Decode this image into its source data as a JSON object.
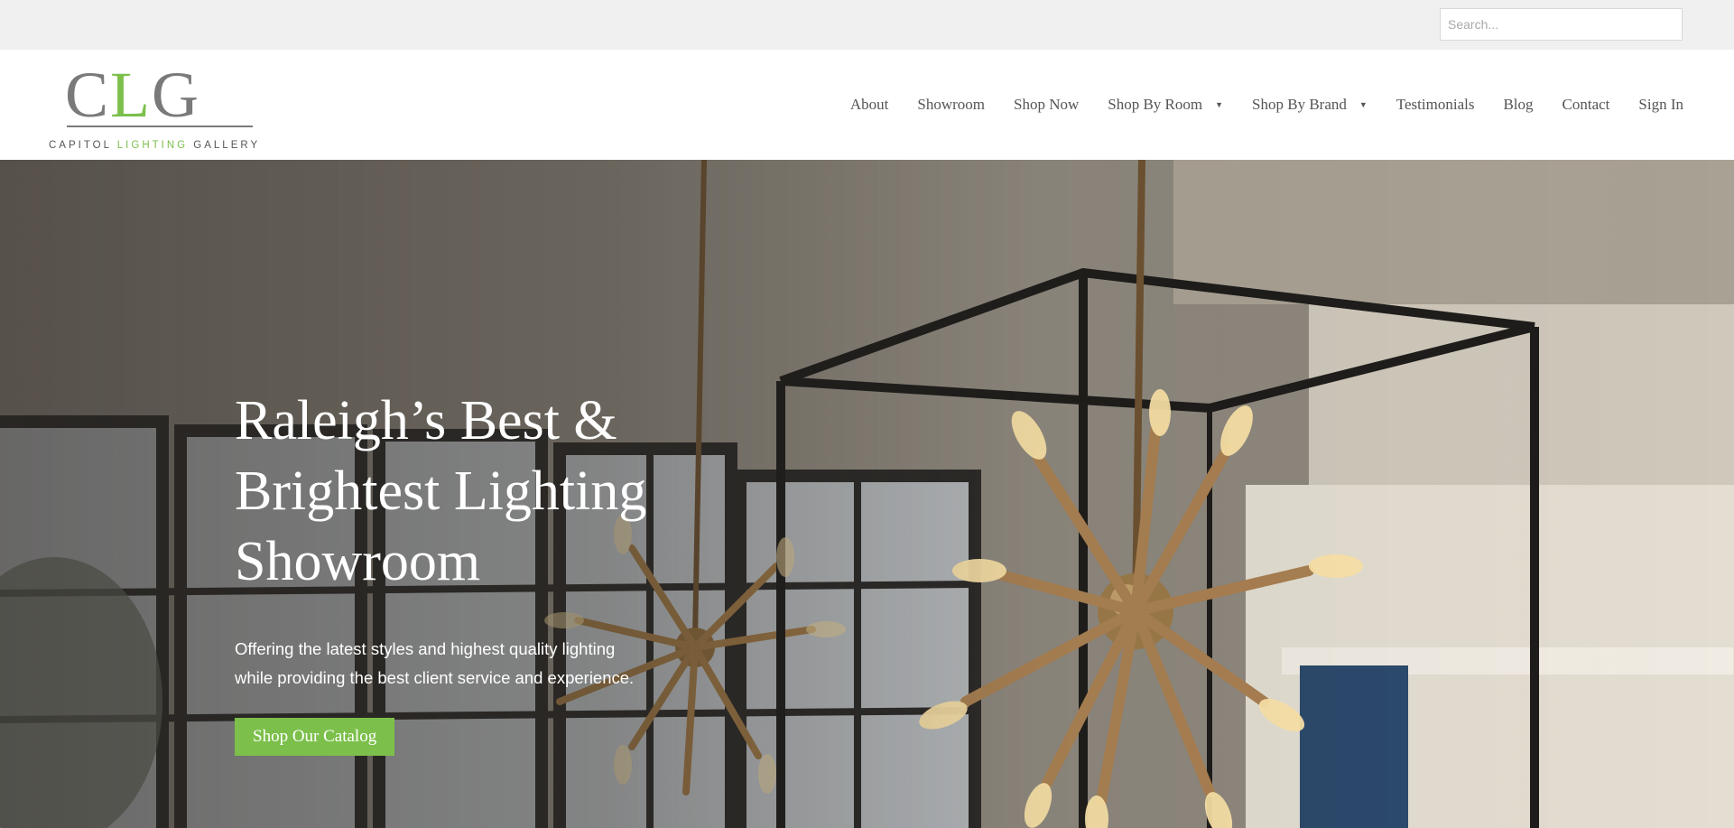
{
  "search": {
    "placeholder": "Search..."
  },
  "logo": {
    "mark_c": "C",
    "mark_l": "L",
    "mark_g": "G",
    "word_capitol": "CAPITOL",
    "word_lighting": "LIGHTING",
    "word_gallery": "GALLERY"
  },
  "nav": {
    "items": [
      {
        "label": "About",
        "has_dropdown": false
      },
      {
        "label": "Showroom",
        "has_dropdown": false
      },
      {
        "label": "Shop Now",
        "has_dropdown": false
      },
      {
        "label": "Shop By Room",
        "has_dropdown": true
      },
      {
        "label": "Shop By Brand",
        "has_dropdown": true
      },
      {
        "label": "Testimonials",
        "has_dropdown": false
      },
      {
        "label": "Blog",
        "has_dropdown": false
      },
      {
        "label": "Contact",
        "has_dropdown": false
      },
      {
        "label": "Sign In",
        "has_dropdown": false
      }
    ],
    "caret": "▼"
  },
  "hero": {
    "title_line1": "Raleigh’s Best &",
    "title_line2": "Brightest Lighting",
    "title_line3": "Showroom",
    "subtitle_line1": "Offering the latest styles and highest quality lighting",
    "subtitle_line2": "while providing the best client service and experience.",
    "cta_label": "Shop Our Catalog"
  },
  "colors": {
    "brand_green": "#7cc04b",
    "logo_gray": "#7a7a7a",
    "nav_text": "#555555",
    "utility_bar": "#f0f0f0"
  }
}
